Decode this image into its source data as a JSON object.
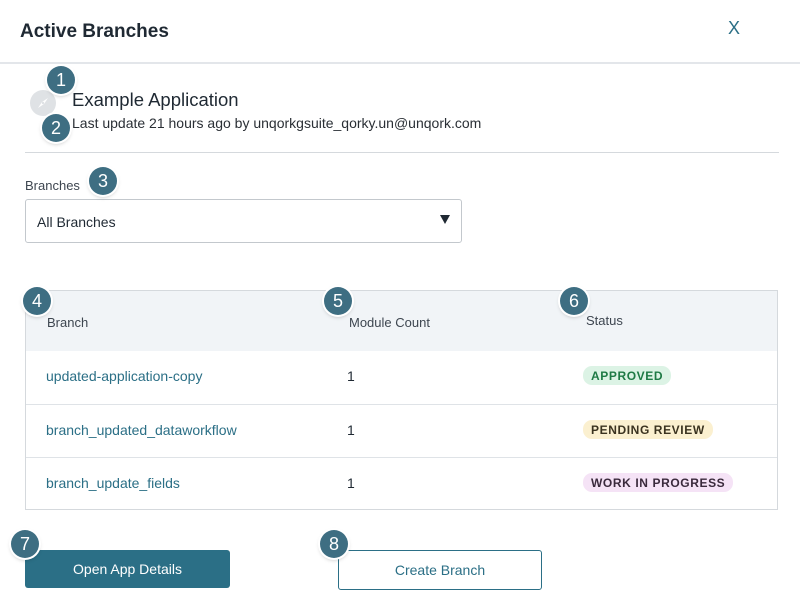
{
  "modal": {
    "title": "Active Branches",
    "close_label": "X"
  },
  "app": {
    "icon": "compass-icon",
    "name": "Example Application",
    "meta": "Last update 21 hours ago by unqorkgsuite_qorky.un@unqork.com"
  },
  "branches_field": {
    "label": "Branches",
    "selected": "All Branches"
  },
  "table": {
    "headers": {
      "branch": "Branch",
      "module_count": "Module Count",
      "status": "Status"
    },
    "rows": [
      {
        "branch": "updated-application-copy",
        "module_count": "1",
        "status": "APPROVED"
      },
      {
        "branch": "branch_updated_dataworkflow",
        "module_count": "1",
        "status": "PENDING REVIEW"
      },
      {
        "branch": "branch_update_fields",
        "module_count": "1",
        "status": "WORK IN PROGRESS"
      }
    ]
  },
  "buttons": {
    "open_app_details": "Open App Details",
    "create_branch": "Create Branch"
  },
  "markers": [
    "1",
    "2",
    "3",
    "4",
    "5",
    "6",
    "7",
    "8"
  ],
  "colors": {
    "accent": "#2b6f86",
    "marker": "#3e6e82",
    "approved_bg": "#dcf3e5",
    "approved_fg": "#1e7a45",
    "pending_bg": "#fbf0d0",
    "pending_fg": "#3b3320",
    "wip_bg": "#f5e3f6",
    "wip_fg": "#3a2a3c"
  }
}
